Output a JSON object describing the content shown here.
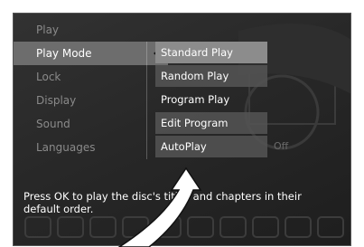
{
  "menu": {
    "items": [
      {
        "label": "Play"
      },
      {
        "label": "Play Mode"
      },
      {
        "label": "Lock"
      },
      {
        "label": "Display"
      },
      {
        "label": "Sound"
      },
      {
        "label": "Languages"
      }
    ],
    "active_index": 1
  },
  "submenu": {
    "items": [
      {
        "label": "Standard Play",
        "style": "highlight"
      },
      {
        "label": "Random Play",
        "style": "boxed"
      },
      {
        "label": "Program Play",
        "style": "plain"
      },
      {
        "label": "Edit Program",
        "style": "boxed"
      },
      {
        "label": "AutoPlay",
        "style": "boxed"
      }
    ],
    "autoplay_value": "Off"
  },
  "help_text": "Press OK to play the disc's titles and chapters in their default order.",
  "colors": {
    "screen_bg": "#2a2a2a",
    "active_item_bg": "#6d6d6d",
    "highlight_bg": "#8c8c8c",
    "dim_text": "#8a8a8a"
  }
}
